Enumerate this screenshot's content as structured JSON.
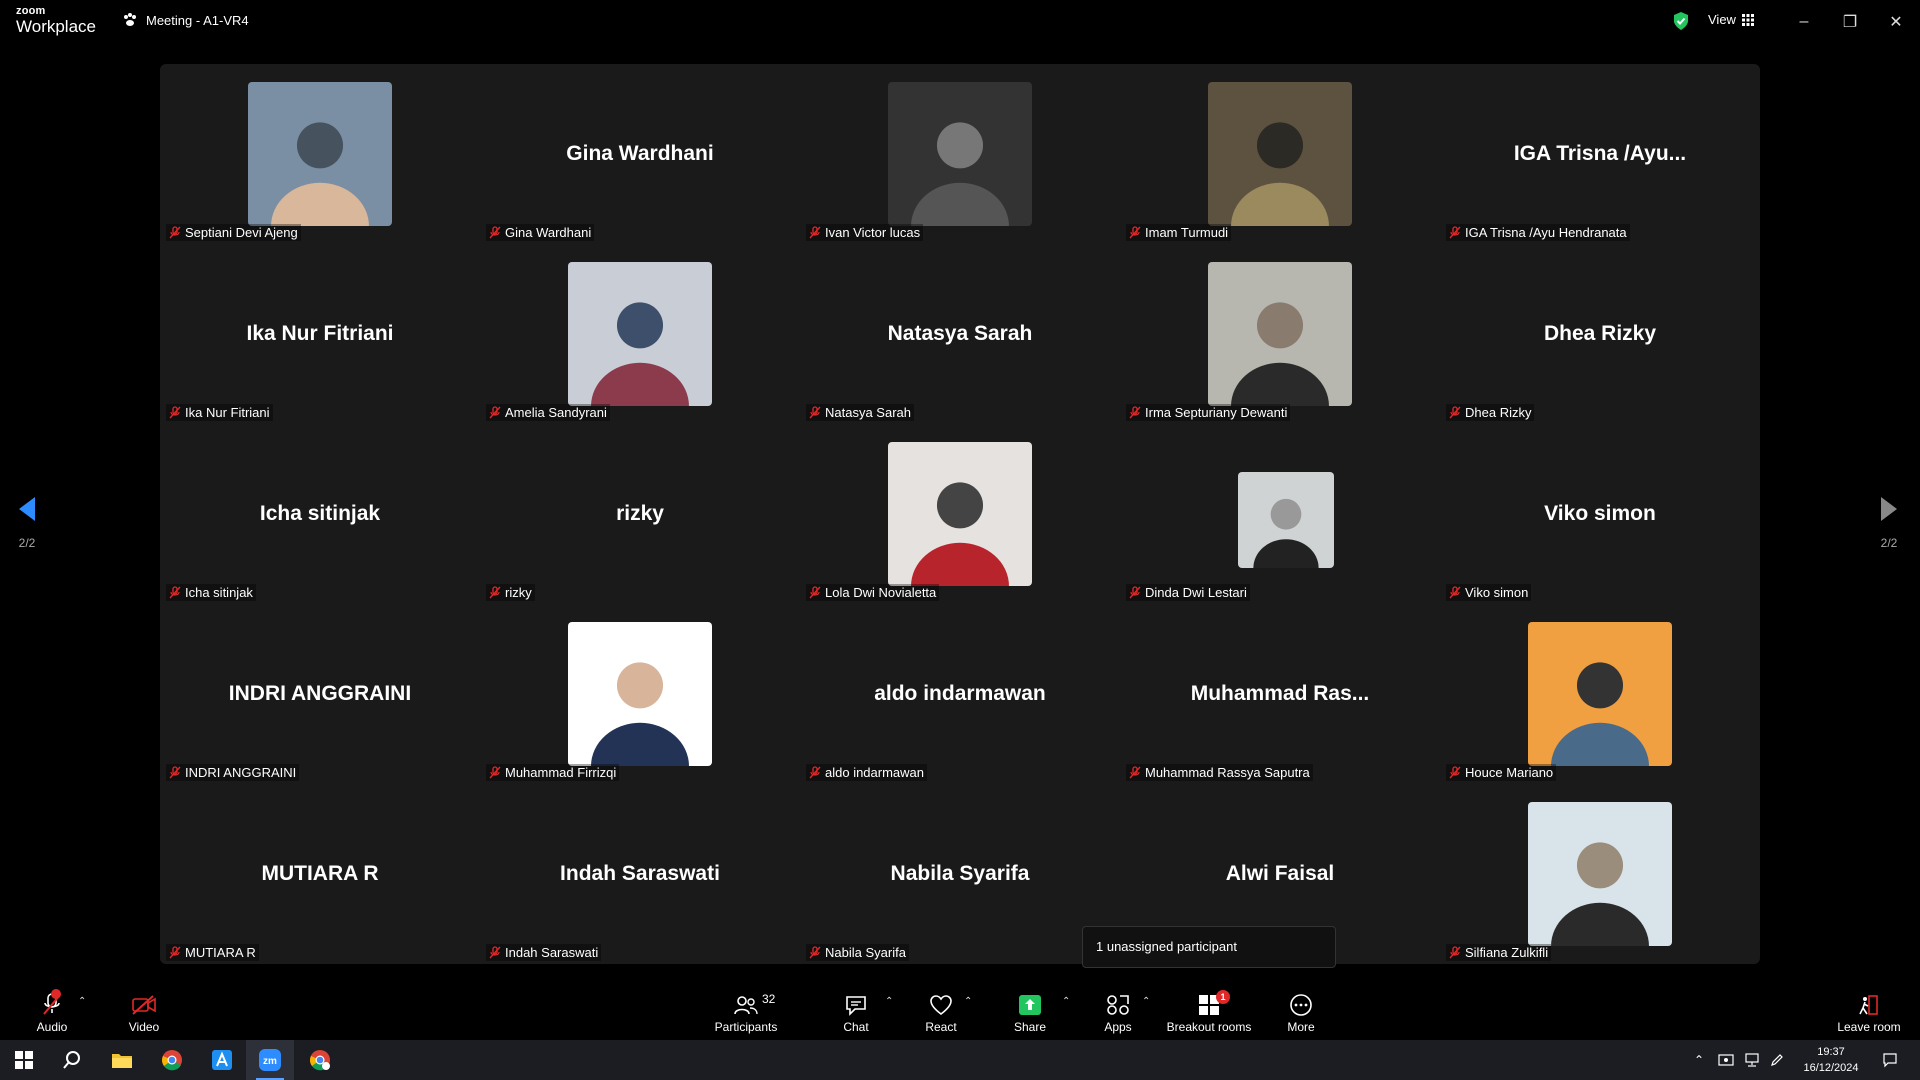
{
  "app": {
    "brand_top": "zoom",
    "brand_bottom": "Workplace",
    "meeting_title": "Meeting - A1-VR4",
    "view_label": "View"
  },
  "colors": {
    "stage_bg": "#1a1a1a",
    "accent_blue": "#2d8cff",
    "muted_red": "#e02828",
    "share_green": "#22c55e"
  },
  "tiles": [
    {
      "label": "Septiani Devi Ajeng",
      "display": "",
      "photo": true
    },
    {
      "label": "Gina Wardhani",
      "display": "Gina Wardhani",
      "photo": false
    },
    {
      "label": "Ivan Victor lucas",
      "display": "",
      "photo": true
    },
    {
      "label": "Imam Turmudi",
      "display": "",
      "photo": true
    },
    {
      "label": "IGA Trisna /Ayu Hendranata",
      "display": "IGA Trisna /Ayu...",
      "photo": false
    },
    {
      "label": "Ika Nur Fitriani",
      "display": "Ika Nur Fitriani",
      "photo": false
    },
    {
      "label": "Amelia Sandyrani",
      "display": "",
      "photo": true
    },
    {
      "label": "Natasya Sarah",
      "display": "Natasya Sarah",
      "photo": false
    },
    {
      "label": "Irma Septuriany Dewanti",
      "display": "",
      "photo": true
    },
    {
      "label": "Dhea Rizky",
      "display": "Dhea Rizky",
      "photo": false
    },
    {
      "label": "Icha sitinjak",
      "display": "Icha sitinjak",
      "photo": false
    },
    {
      "label": "rizky",
      "display": "rizky",
      "photo": false
    },
    {
      "label": "Lola Dwi Novialetta",
      "display": "",
      "photo": true
    },
    {
      "label": "Dinda Dwi Lestari",
      "display": "",
      "photo": true,
      "small": true
    },
    {
      "label": "Viko simon",
      "display": "Viko simon",
      "photo": false
    },
    {
      "label": "INDRI ANGGRAINI",
      "display": "INDRI ANGGRAINI",
      "photo": false
    },
    {
      "label": "Muhammad Firrizqi",
      "display": "",
      "photo": true
    },
    {
      "label": "aldo indarmawan",
      "display": "aldo indarmawan",
      "photo": false
    },
    {
      "label": "Muhammad Rassya Saputra",
      "display": "Muhammad  Ras...",
      "photo": false
    },
    {
      "label": "Houce Mariano",
      "display": "",
      "photo": true
    },
    {
      "label": "MUTIARA R",
      "display": "MUTIARA R",
      "photo": false
    },
    {
      "label": "Indah Saraswati",
      "display": "Indah Saraswati",
      "photo": false
    },
    {
      "label": "Nabila Syarifa",
      "display": "Nabila Syarifa",
      "photo": false
    },
    {
      "label": "Alwi Faisal",
      "display": "Alwi Faisal",
      "photo": false
    },
    {
      "label": "Silfiana Zulkifli",
      "display": "",
      "photo": true
    }
  ],
  "pager": {
    "left": "2/2",
    "right": "2/2"
  },
  "tooltip": "1 unassigned participant",
  "toolbar": {
    "audio": "Audio",
    "video": "Video",
    "participants": "Participants",
    "participants_count": "32",
    "chat": "Chat",
    "react": "React",
    "share": "Share",
    "apps": "Apps",
    "breakout": "Breakout rooms",
    "breakout_badge": "1",
    "more": "More",
    "leave": "Leave room"
  },
  "taskbar": {
    "time": "19:37",
    "date": "16/12/2024"
  }
}
